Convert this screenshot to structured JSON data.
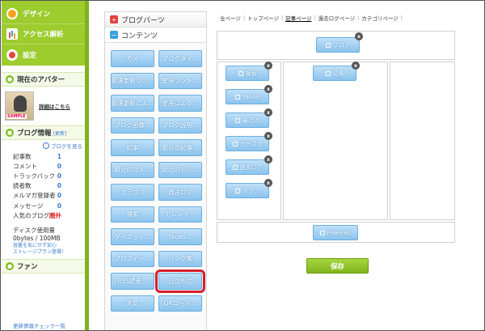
{
  "topnav": {
    "design": "デザイン",
    "access": "アクセス解析",
    "settings": "設定"
  },
  "avatar_panel": {
    "title": "現在のアバター",
    "link": "詳細はこちら",
    "sample": "SAMPLE"
  },
  "blog_info": {
    "title": "ブログ情報",
    "update": "[更新]",
    "view_link": "ブログを見る",
    "stats": [
      {
        "label": "記事数",
        "value": "1"
      },
      {
        "label": "コメント",
        "value": "0"
      },
      {
        "label": "トラックバック",
        "value": "0"
      },
      {
        "label": "読者数",
        "value": "0"
      },
      {
        "label": "メルマガ登録者",
        "value": "0"
      },
      {
        "label": "メッセージ",
        "value": "0"
      },
      {
        "label": "人気のブログ",
        "value": "圏外"
      }
    ],
    "disk_title": "ディスク使用量",
    "disk_value": "0bytes / 100MB",
    "disk_note1": "容量を気にせず安心",
    "disk_note2": "ストレージプラン登場！"
  },
  "fan_panel": {
    "title": "ファン",
    "bottom_link": "更新情報チェック一覧"
  },
  "parts": {
    "blog_parts": "ブログパーツ",
    "contents": "コンテンツ",
    "items": [
      "カメ",
      "ブログタイ…",
      "最速更新ラン…",
      "星座ランキ…",
      "最速更新によ…",
      "星座による…",
      "ブログ画像…",
      "ブログ説明…",
      "記事",
      "最近の記事…",
      "最近のコメ…",
      "最近のトラ…",
      "カテゴリ",
      "過去ログ",
      "検索",
      "カレンダー",
      "ダイエット…",
      "faceb…",
      "プロフィー…",
      "リンク集",
      "RSS読者…",
      "自由形式",
      "天気",
      "QRコード…"
    ]
  },
  "layout": {
    "tabs": [
      "全ページ",
      "トップページ",
      "記事ページ",
      "過去ログページ",
      "カテゴリページ"
    ],
    "header_widget": "ブログ",
    "left_widgets": [
      "検索",
      "Yahoo",
      "最近の",
      "カテゴリ",
      "過去ログ",
      "タグク"
    ],
    "center_widget": "記事",
    "footer_widget": "Powered",
    "close": "x",
    "save": "保存"
  }
}
